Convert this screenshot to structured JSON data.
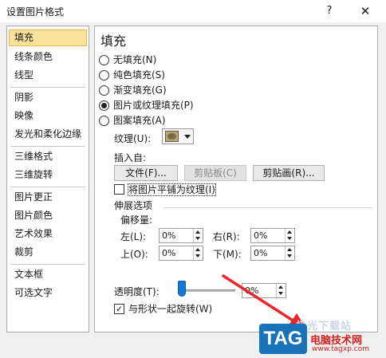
{
  "window": {
    "title": "设置图片格式",
    "help_glyph": "?",
    "close_glyph": "✕"
  },
  "nav": {
    "items": [
      {
        "label": "填充",
        "selected": true
      },
      {
        "label": "线条颜色"
      },
      {
        "label": "线型"
      },
      {
        "label": "阴影"
      },
      {
        "label": "映像"
      },
      {
        "label": "发光和柔化边缘"
      },
      {
        "label": "三维格式"
      },
      {
        "label": "三维旋转"
      },
      {
        "label": "图片更正"
      },
      {
        "label": "图片颜色"
      },
      {
        "label": "艺术效果"
      },
      {
        "label": "裁剪"
      },
      {
        "label": "文本框"
      },
      {
        "label": "可选文字"
      }
    ]
  },
  "panel": {
    "title": "填充",
    "fill_options": [
      {
        "label": "无填充(N)",
        "checked": false
      },
      {
        "label": "纯色填充(S)",
        "checked": false
      },
      {
        "label": "渐变填充(G)",
        "checked": false
      },
      {
        "label": "图片或纹理填充(P)",
        "checked": true
      },
      {
        "label": "图案填充(A)",
        "checked": false
      }
    ],
    "texture_label": "纹理(U):",
    "insert_from_label": "插入自:",
    "buttons": {
      "file": "文件(F)...",
      "clipboard": "剪贴板(C)",
      "clipart": "剪贴画(R)..."
    },
    "tile_checkbox": {
      "label": "将图片平铺为纹理(I)",
      "checked": false
    },
    "stretch_options_label": "伸展选项",
    "offset_label": "偏移量:",
    "offsets": {
      "left": {
        "label": "左(L):",
        "value": "0%"
      },
      "right": {
        "label": "右(R):",
        "value": "0%"
      },
      "top": {
        "label": "上(O):",
        "value": "0%"
      },
      "bottom": {
        "label": "下(M):",
        "value": "0%"
      }
    },
    "transparency": {
      "label": "透明度(T):",
      "value": "0%",
      "level": 0
    },
    "rotate_checkbox": {
      "label": "与形状一起旋转(W)",
      "checked": true
    }
  },
  "watermark": {
    "badge": "TAG",
    "top_text": "极光下载站",
    "site_name": "电脑技术网",
    "url": "www.tagxp.com"
  },
  "colors": {
    "selected_nav_bg": "#fbe29a",
    "accent_arrow": "#e8262b",
    "slider_thumb": "#1478d4"
  }
}
